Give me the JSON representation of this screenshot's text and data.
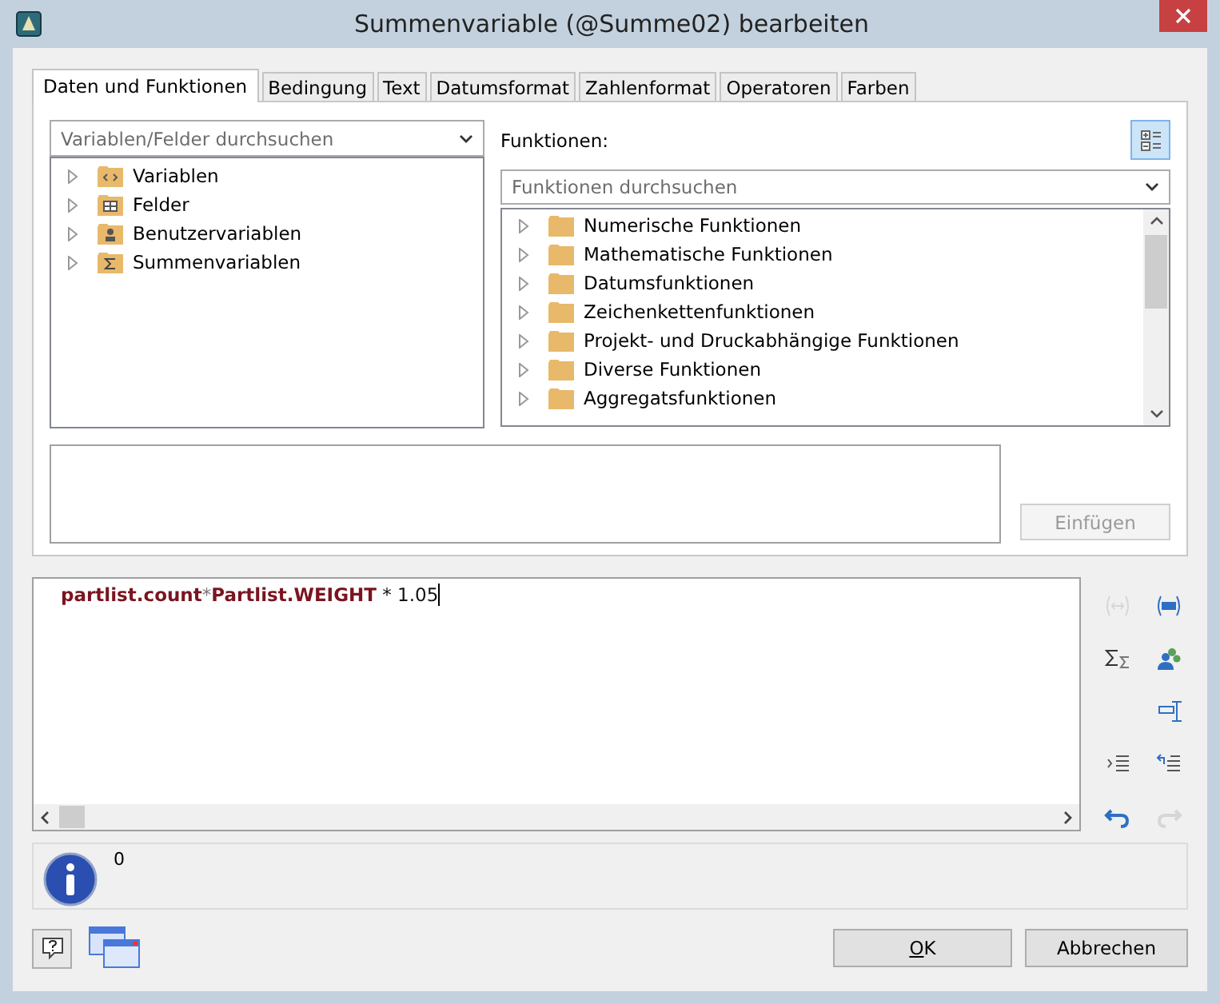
{
  "window": {
    "title": "Summenvariable (@Summe02) bearbeiten"
  },
  "tabs": [
    {
      "label": "Daten und Funktionen",
      "selected": true
    },
    {
      "label": "Bedingung",
      "selected": false
    },
    {
      "label": "Text",
      "selected": false
    },
    {
      "label": "Datumsformat",
      "selected": false
    },
    {
      "label": "Zahlenformat",
      "selected": false
    },
    {
      "label": "Operatoren",
      "selected": false
    },
    {
      "label": "Farben",
      "selected": false
    }
  ],
  "variables": {
    "search": {
      "placeholder": "Variablen/Felder durchsuchen"
    },
    "tree": [
      {
        "label": "Variablen",
        "kind": "variables",
        "expanded": false
      },
      {
        "label": "Felder",
        "kind": "fields",
        "expanded": false
      },
      {
        "label": "Benutzervariablen",
        "kind": "user",
        "expanded": false
      },
      {
        "label": "Summenvariablen",
        "kind": "sum",
        "expanded": false
      }
    ]
  },
  "functions": {
    "label": "Funktionen:",
    "search": {
      "placeholder": "Funktionen durchsuchen"
    },
    "tree": [
      {
        "label": "Numerische Funktionen",
        "expanded": false
      },
      {
        "label": "Mathematische Funktionen",
        "expanded": false
      },
      {
        "label": "Datumsfunktionen",
        "expanded": false
      },
      {
        "label": "Zeichenkettenfunktionen",
        "expanded": false
      },
      {
        "label": "Projekt- und Druckabhängige Funktionen",
        "expanded": false
      },
      {
        "label": "Diverse Funktionen",
        "expanded": false
      },
      {
        "label": "Aggregatsfunktionen",
        "expanded": false
      }
    ]
  },
  "insert_button": {
    "label": "Einfügen",
    "disabled": true
  },
  "formula": [
    {
      "text": "partlist.count",
      "kind": "field"
    },
    {
      "text": "*",
      "kind": "operator"
    },
    {
      "text": "Partlist.WEIGHT",
      "kind": "field"
    },
    {
      "text": " * 1.05",
      "kind": "plain"
    }
  ],
  "toolbar": [
    [
      {
        "kind": "brackets",
        "disabled": true
      },
      {
        "kind": "parentheses",
        "disabled": false
      }
    ],
    [
      {
        "kind": "sigma",
        "disabled": false
      },
      {
        "kind": "people",
        "disabled": false
      }
    ],
    [
      {
        "kind": "wrap",
        "disabled": false
      }
    ],
    [
      {
        "kind": "indent",
        "disabled": false
      },
      {
        "kind": "outdent",
        "disabled": false
      }
    ],
    [
      {
        "kind": "undo",
        "disabled": false
      },
      {
        "kind": "redo",
        "disabled": true
      }
    ]
  ],
  "result": {
    "text": "0"
  },
  "buttons": [
    {
      "label": "OK"
    },
    {
      "label": "Abbrechen"
    }
  ]
}
